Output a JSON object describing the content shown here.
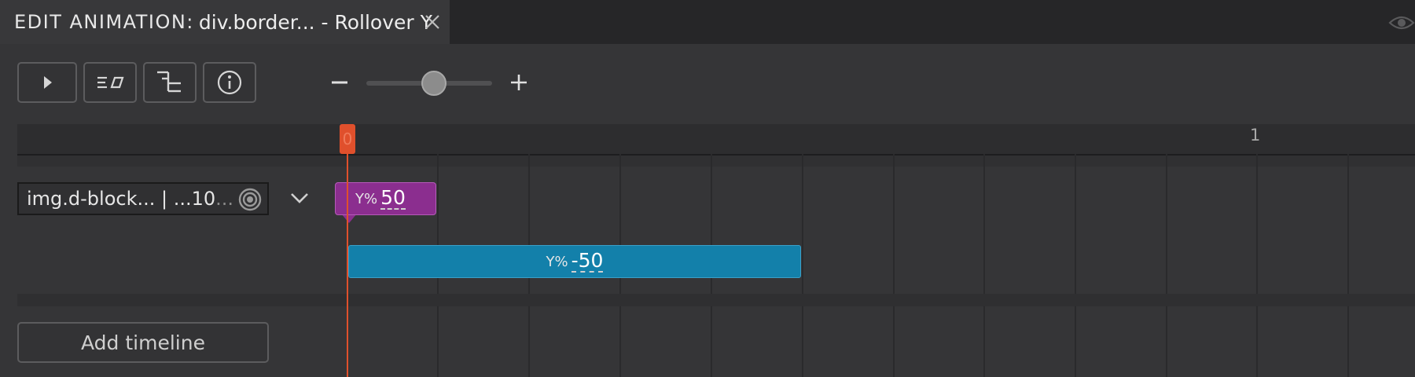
{
  "tab": {
    "prefix": "EDIT ANIMATION:",
    "title": "div.border... - Rollover Y"
  },
  "toolbar": {
    "buttons": [
      {
        "name": "play-icon"
      },
      {
        "name": "easing-icon"
      },
      {
        "name": "timeline-tree-icon"
      },
      {
        "name": "info-icon"
      }
    ],
    "zoom": {
      "minus": "−",
      "plus": "+",
      "level": 0.5
    }
  },
  "ruler": {
    "labels": [
      "0",
      "1"
    ]
  },
  "timeline": {
    "target_label": "img.d-block... | ...10",
    "target_overflow": "...",
    "keyframes": [
      {
        "property": "Y%",
        "value": "50",
        "color": "#8b2e8f"
      },
      {
        "property": "Y%",
        "value": "-50",
        "color": "#1380aa"
      }
    ]
  },
  "add_timeline_label": "Add timeline",
  "colors": {
    "playhead": "#e0502c",
    "background": "#353537"
  }
}
